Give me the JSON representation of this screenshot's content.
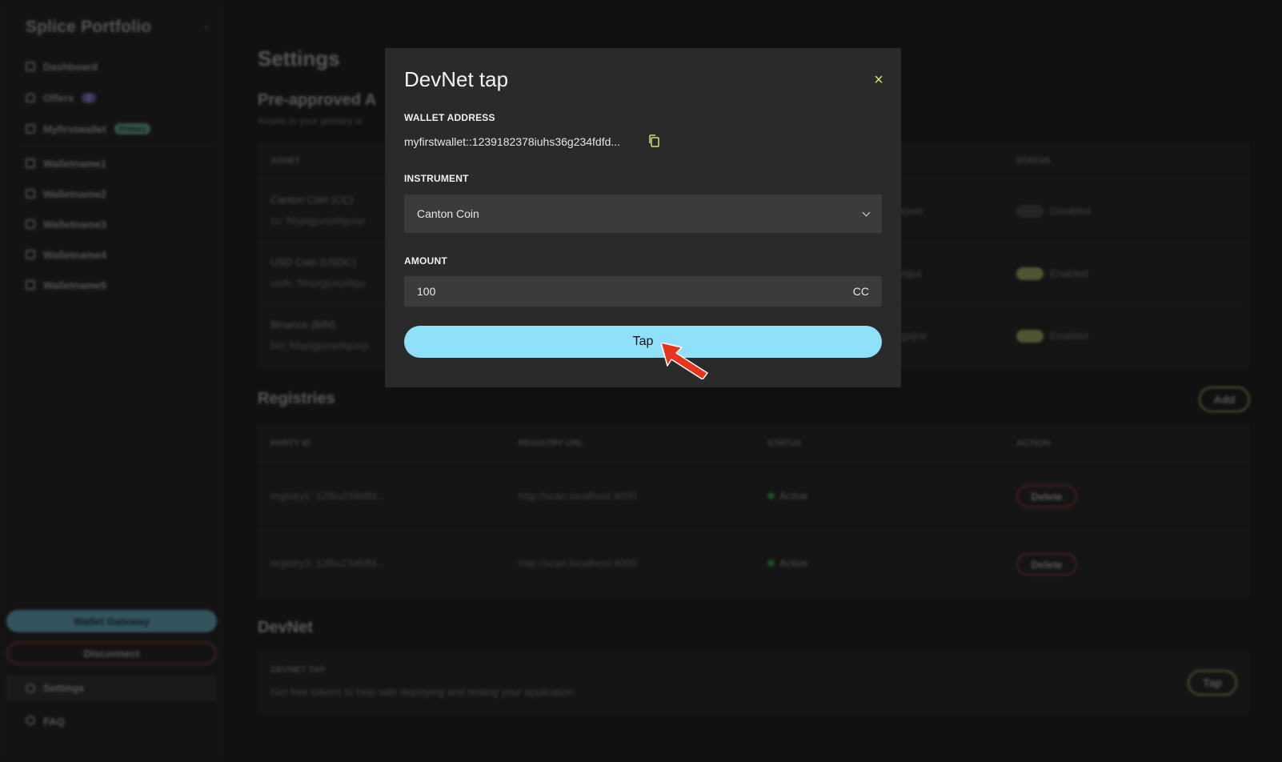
{
  "sidebar": {
    "brand": "Splice Portfolio",
    "collapse_glyph": "‹",
    "items": [
      {
        "label": "Dashboard",
        "icon": "grid-icon"
      },
      {
        "label": "Offers",
        "icon": "bell-icon",
        "badge": "2"
      },
      {
        "label": "Myfirstwallet",
        "icon": "wallet-icon",
        "badge": "Primary"
      },
      {
        "label": "Walletname1",
        "icon": "wallet-icon"
      },
      {
        "label": "Walletname2",
        "icon": "wallet-icon"
      },
      {
        "label": "Walletname3",
        "icon": "wallet-icon"
      },
      {
        "label": "Walletname4",
        "icon": "wallet-icon"
      },
      {
        "label": "Walletname5",
        "icon": "wallet-icon"
      }
    ],
    "gateway_button": "Wallet Gateway",
    "disconnect_button": "Disconnect",
    "settings_label": "Settings",
    "faq_label": "FAQ"
  },
  "page": {
    "title": "Settings",
    "preapproved": {
      "title": "Pre-approved A",
      "subtitle": "Assets in your primary w",
      "headers": {
        "asset": "ASSET",
        "status": "STATUS"
      },
      "rows": [
        {
          "asset": "Canton Coin (CC)",
          "id": "cc::fdspigjuepi9gusp",
          "party_tail": "ejwie",
          "status": "Disabled",
          "enabled": false
        },
        {
          "asset": "USD Coin (USDC)",
          "id": "usdc::fdspigjuepi9gu",
          "party_tail": "eijpa",
          "status": "Enabled",
          "enabled": true
        },
        {
          "asset": "Binance (BIN)",
          "id": "bin::fdspigjuepi9gusp",
          "party_tail": "gpijrw",
          "status": "Enabled",
          "enabled": true
        }
      ]
    },
    "registries": {
      "title": "Registries",
      "add_button": "Add",
      "headers": {
        "party_id": "PARTY ID",
        "registry_url": "REGISTRY URL",
        "status": "STATUS",
        "action": "ACTION"
      },
      "rows": [
        {
          "party_id": "registry1::128iu234fdfd...",
          "url": "http://scan.localhost:4000",
          "status": "Active",
          "action": "Delete"
        },
        {
          "party_id": "registry2::128iu234fdfd...",
          "url": "http://scan.localhost:4000",
          "status": "Active",
          "action": "Delete"
        }
      ]
    },
    "devnet": {
      "title": "DevNet",
      "card_label": "DEVNET TAP",
      "card_desc": "Get free tokens to help with deploying and testing your application.",
      "tap_button": "Tap"
    }
  },
  "modal": {
    "title": "DevNet tap",
    "close_glyph": "×",
    "wallet_label": "WALLET ADDRESS",
    "wallet_address": "myfirstwallet::1239182378iuhs36g234fdfd...",
    "instrument_label": "INSTRUMENT",
    "instrument_value": "Canton Coin",
    "amount_label": "AMOUNT",
    "amount_value": "100",
    "amount_unit": "CC",
    "tap_button": "Tap",
    "colors": {
      "tap_bg": "#8fe1fa",
      "accent": "#d6e07a",
      "arrow": "#e8331f"
    }
  }
}
